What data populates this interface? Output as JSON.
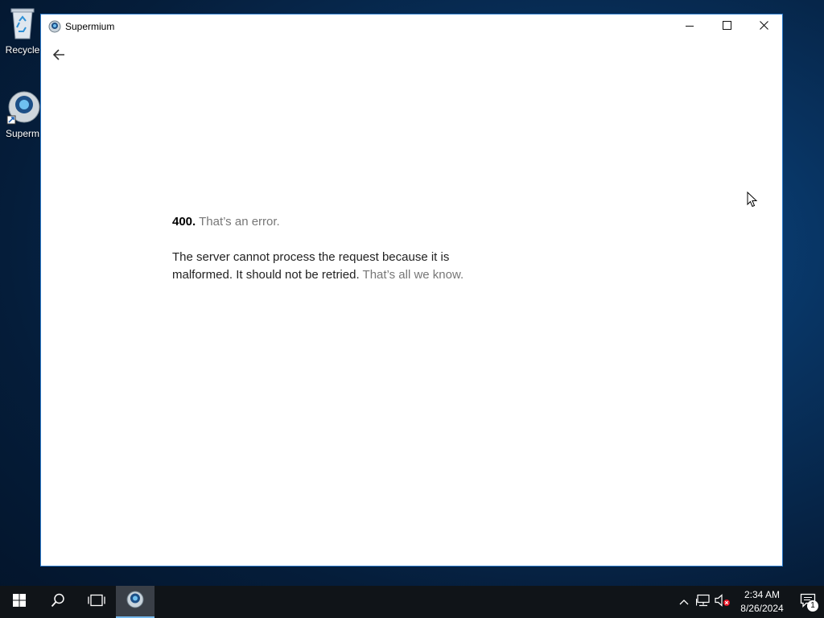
{
  "desktop": {
    "icons": [
      {
        "label": "Recycle",
        "icon": "recycle-bin-icon"
      },
      {
        "label": "Superm",
        "icon": "supermium-icon"
      }
    ]
  },
  "window": {
    "title": "Supermium",
    "app_icon": "supermium-icon",
    "controls": [
      "minimize-icon",
      "maximize-icon",
      "close-icon"
    ],
    "back_icon": "back-arrow-icon"
  },
  "error_page": {
    "code": "400.",
    "short_message": "That’s an error.",
    "description": "The server cannot process the request because it is malformed. It should not be retried.",
    "trailer": "That’s all we know."
  },
  "taskbar": {
    "buttons": [
      "windows-start-icon",
      "search-icon",
      "task-view-icon",
      "supermium-taskbar-icon"
    ],
    "tray_icons": [
      "chevron-up-icon",
      "network-icon",
      "volume-muted-icon"
    ],
    "clock": {
      "time": "2:34 AM",
      "date": "8/26/2024"
    },
    "notifications_count": "1"
  },
  "colors": {
    "window_border": "#2b79c9",
    "taskbar_bg": "#101418",
    "active_indicator": "#76b9ed",
    "muted_text": "#777777"
  }
}
